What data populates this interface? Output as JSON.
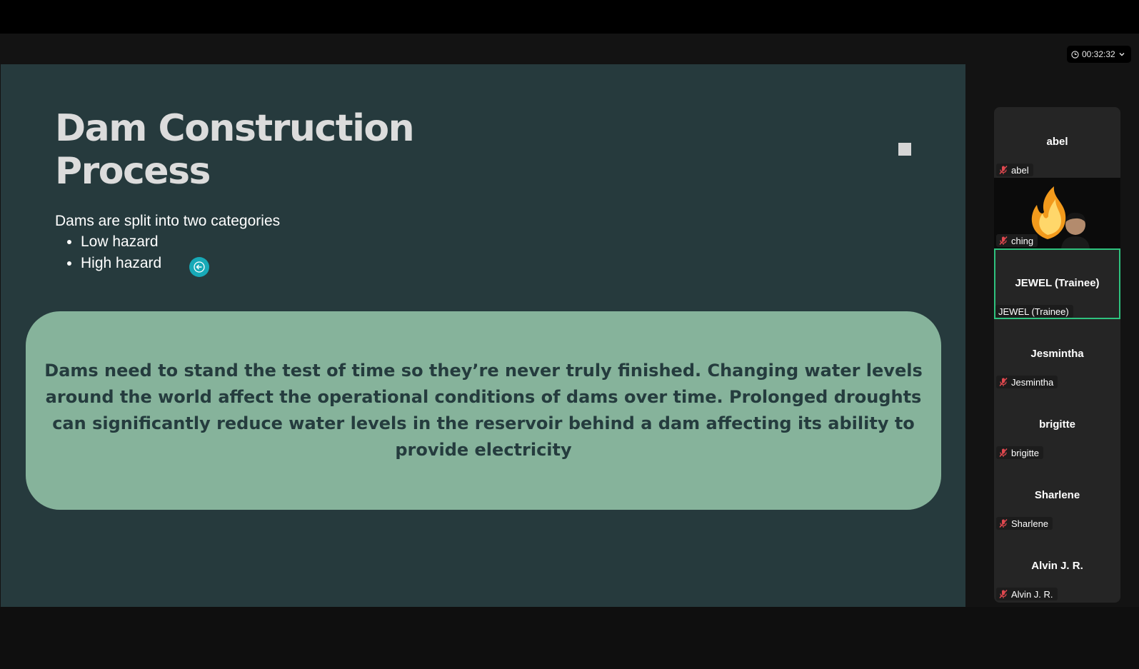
{
  "timer": {
    "time": "00:32:32"
  },
  "slide": {
    "title": "Dam Construction Process",
    "intro": "Dams are split into two categories",
    "bullets": [
      "Low hazard",
      "High hazard"
    ],
    "callout": "Dams need to stand the test of time so they’re never truly finished. Changing water levels around the world affect the operational conditions of dams over time. Prolonged droughts can significantly reduce water levels in the reservoir behind a dam affecting its ability to provide electricity"
  },
  "participants": [
    {
      "display": "abel",
      "label": "abel",
      "muted": true
    },
    {
      "display": "",
      "label": "ching",
      "muted": true,
      "video": true
    },
    {
      "display": "JEWEL (Trainee)",
      "label": "JEWEL (Trainee)",
      "muted": false,
      "speaking": true
    },
    {
      "display": "Jesmintha",
      "label": "Jesmintha",
      "muted": true
    },
    {
      "display": "brigitte",
      "label": "brigitte",
      "muted": true
    },
    {
      "display": "Sharlene",
      "label": "Sharlene",
      "muted": true
    },
    {
      "display": "Alvin J. R.",
      "label": "Alvin J. R.",
      "muted": true
    }
  ],
  "colors": {
    "slide_bg": "#263a3d",
    "callout_bg": "#86b39b",
    "active_speaker": "#2ec27e",
    "muted_icon": "#e0484f",
    "pointer": "#17a9b7"
  },
  "icons": [
    "clock-icon",
    "chevron-down-icon",
    "muted-mic-icon",
    "arrow-left-icon"
  ]
}
